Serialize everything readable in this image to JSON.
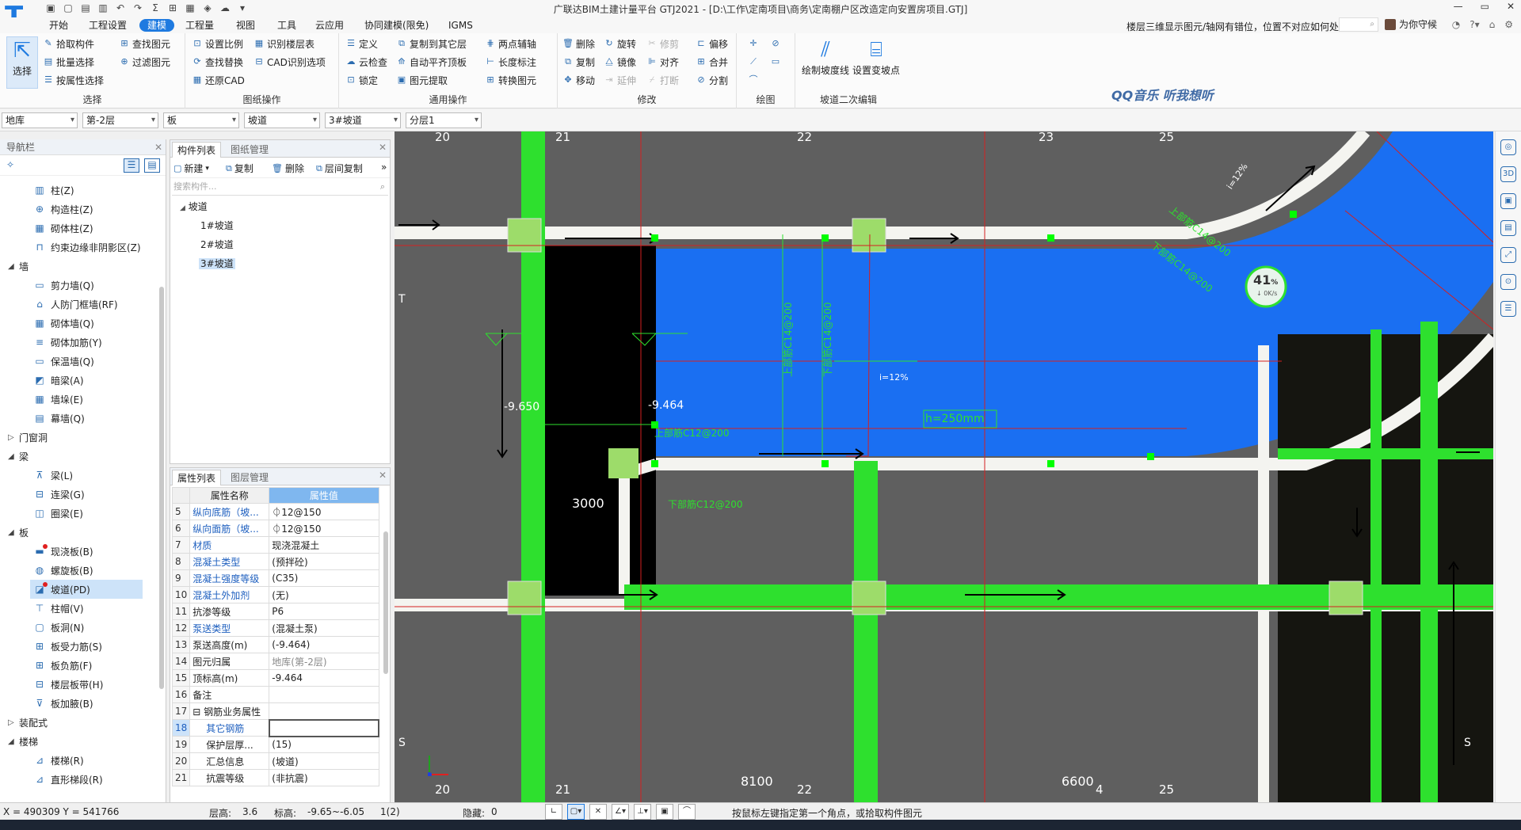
{
  "window": {
    "title": "广联达BIM土建计量平台 GTJ2021 - [D:\\工作\\定南项目\\商务\\定南棚户区改造定向安置房项目.GTJ]",
    "controls": [
      "—",
      "▭",
      "✕"
    ]
  },
  "menu": {
    "items": [
      "开始",
      "工程设置",
      "建模",
      "工程量",
      "视图",
      "工具",
      "云应用",
      "协同建模(限免)",
      "IGMS"
    ],
    "active": "建模",
    "notice": "楼层三维显示图元/轴网有错位，位置不对应如何处理?",
    "user": "为你守候"
  },
  "ribbon": {
    "select": {
      "big": "选择",
      "items": [
        "拾取构件",
        "批量选择",
        "按属性选择"
      ],
      "items2": [
        "查找图元",
        "过滤图元"
      ],
      "title": "选择"
    },
    "drawing": {
      "col1": [
        "设置比例",
        "查找替换",
        "还原CAD"
      ],
      "col2": [
        "识别楼层表",
        "CAD识别选项"
      ],
      "title": "图纸操作"
    },
    "general": {
      "col1": [
        "定义",
        "云检查",
        "锁定"
      ],
      "col2": [
        "复制到其它层",
        "自动平齐顶板",
        "图元提取"
      ],
      "col3": [
        "两点辅轴",
        "长度标注",
        "转换图元"
      ],
      "title": "通用操作"
    },
    "modify": {
      "col1": [
        "删除",
        "复制",
        "移动"
      ],
      "col2": [
        "旋转",
        "镜像",
        "延伸"
      ],
      "col3": [
        "修剪",
        "对齐",
        "打断"
      ],
      "col4": [
        "偏移",
        "合并",
        "分割"
      ],
      "title": "修改"
    },
    "draw": {
      "title": "绘图"
    },
    "ramp": {
      "b1": "绘制坡度线",
      "b2": "设置变坡点",
      "title": "坡道二次编辑"
    },
    "watermark": "QQ音乐 听我想听"
  },
  "filters": [
    "地库",
    "第-2层",
    "板",
    "坡道",
    "3#坡道",
    "分层1"
  ],
  "nav": {
    "title": "导航栏",
    "rows": [
      {
        "type": "sub",
        "icon": "▥",
        "label": "柱(Z)"
      },
      {
        "type": "sub",
        "icon": "⊕",
        "label": "构造柱(Z)"
      },
      {
        "type": "sub",
        "icon": "▦",
        "label": "砌体柱(Z)"
      },
      {
        "type": "sub",
        "icon": "⊓",
        "label": "约束边缘非阴影区(Z)"
      },
      {
        "type": "cat",
        "label": "墙",
        "open": true
      },
      {
        "type": "sub",
        "icon": "▭",
        "label": "剪力墙(Q)"
      },
      {
        "type": "sub",
        "icon": "⌂",
        "label": "人防门框墙(RF)"
      },
      {
        "type": "sub",
        "icon": "▦",
        "label": "砌体墙(Q)"
      },
      {
        "type": "sub",
        "icon": "≡",
        "label": "砌体加筋(Y)"
      },
      {
        "type": "sub",
        "icon": "▭",
        "label": "保温墙(Q)"
      },
      {
        "type": "sub",
        "icon": "◩",
        "label": "暗梁(A)"
      },
      {
        "type": "sub",
        "icon": "▦",
        "label": "墙垛(E)"
      },
      {
        "type": "sub",
        "icon": "▤",
        "label": "幕墙(Q)"
      },
      {
        "type": "cat",
        "label": "门窗洞",
        "open": false
      },
      {
        "type": "cat",
        "label": "梁",
        "open": true
      },
      {
        "type": "sub",
        "icon": "⊼",
        "label": "梁(L)"
      },
      {
        "type": "sub",
        "icon": "⊟",
        "label": "连梁(G)"
      },
      {
        "type": "sub",
        "icon": "◫",
        "label": "圈梁(E)"
      },
      {
        "type": "cat",
        "label": "板",
        "open": true
      },
      {
        "type": "sub",
        "icon": "▬",
        "label": "现浇板(B)",
        "dot": true
      },
      {
        "type": "sub",
        "icon": "◍",
        "label": "螺旋板(B)"
      },
      {
        "type": "sub",
        "icon": "◪",
        "label": "坡道(PD)",
        "dot": true,
        "selected": true
      },
      {
        "type": "sub",
        "icon": "⊤",
        "label": "柱帽(V)"
      },
      {
        "type": "sub",
        "icon": "▢",
        "label": "板洞(N)"
      },
      {
        "type": "sub",
        "icon": "⊞",
        "label": "板受力筋(S)"
      },
      {
        "type": "sub",
        "icon": "⊞",
        "label": "板负筋(F)"
      },
      {
        "type": "sub",
        "icon": "⊟",
        "label": "楼层板带(H)"
      },
      {
        "type": "sub",
        "icon": "⊽",
        "label": "板加腋(B)"
      },
      {
        "type": "cat",
        "label": "装配式",
        "open": false
      },
      {
        "type": "cat",
        "label": "楼梯",
        "open": true
      },
      {
        "type": "sub",
        "icon": "⊿",
        "label": "楼梯(R)"
      },
      {
        "type": "sub",
        "icon": "⊿",
        "label": "直形梯段(R)"
      }
    ]
  },
  "components": {
    "tabs": [
      "构件列表",
      "图纸管理"
    ],
    "tools": [
      "新建",
      "复制",
      "删除",
      "层间复制"
    ],
    "search_placeholder": "搜索构件...",
    "root": "坡道",
    "items": [
      "1#坡道",
      "2#坡道",
      "3#坡道"
    ],
    "selected": "3#坡道"
  },
  "properties": {
    "tabs": [
      "属性列表",
      "图层管理"
    ],
    "headers": [
      "属性名称",
      "属性值"
    ],
    "rows": [
      {
        "n": "5",
        "name": "纵向底筋（坡...",
        "value": "⏀12@150",
        "blue": true
      },
      {
        "n": "6",
        "name": "纵向面筋（坡...",
        "value": "⏀12@150",
        "blue": true
      },
      {
        "n": "7",
        "name": "材质",
        "value": "现浇混凝土",
        "blue": true
      },
      {
        "n": "8",
        "name": "混凝土类型",
        "value": "(预拌砼)",
        "blue": true
      },
      {
        "n": "9",
        "name": "混凝土强度等级",
        "value": "(C35)",
        "blue": true
      },
      {
        "n": "10",
        "name": "混凝土外加剂",
        "value": "(无)",
        "blue": true
      },
      {
        "n": "11",
        "name": "抗渗等级",
        "value": "P6"
      },
      {
        "n": "12",
        "name": "泵送类型",
        "value": "(混凝土泵)",
        "blue": true
      },
      {
        "n": "13",
        "name": "泵送高度(m)",
        "value": "(-9.464)"
      },
      {
        "n": "14",
        "name": "图元归属",
        "value": "地库(第-2层)",
        "gray": true
      },
      {
        "n": "15",
        "name": "顶标高(m)",
        "value": "-9.464"
      },
      {
        "n": "16",
        "name": "备注",
        "value": ""
      },
      {
        "n": "17",
        "name": "⊟ 钢筋业务属性",
        "value": ""
      },
      {
        "n": "18",
        "name": "其它钢筋",
        "value": "",
        "blue": true,
        "indent": true,
        "selected": true
      },
      {
        "n": "19",
        "name": "保护层厚...",
        "value": "(15)",
        "indent": true
      },
      {
        "n": "20",
        "name": "汇总信息",
        "value": "(坡道)",
        "indent": true
      },
      {
        "n": "21",
        "name": "抗震等级",
        "value": "(非抗震)",
        "indent": true
      }
    ]
  },
  "canvas": {
    "axes_top": [
      "20",
      "21",
      "22",
      "23",
      "25"
    ],
    "axes_bottom": [
      "20",
      "21",
      "22",
      "4",
      "25"
    ],
    "axes_side": [
      "T",
      "S"
    ],
    "dims": [
      "3000",
      "8100",
      "6600"
    ],
    "elevations": [
      "-9.650",
      "-9.464"
    ],
    "rebar": [
      "上部筋C14@200",
      "下部筋C14@200",
      "上部筋C12@200",
      "下部筋C12@200",
      "上部筋C14@200",
      "下部筋C14@200"
    ],
    "slope1": "i=12%",
    "slope2": "i=12%",
    "thickness": "h=250mm",
    "progress": {
      "percent": "41",
      "unit": "%",
      "speed": "↓ 0K/s"
    },
    "colors": {
      "bg": "#5f5f5f",
      "green": "#2ee02e",
      "blue": "#1a6ff2",
      "black": "#000000",
      "white": "#f4f4f0",
      "redline": "#d42020"
    }
  },
  "status": {
    "coords": "X = 490309 Y = 541766",
    "floor_height_label": "层高:",
    "floor_height": "3.6",
    "elev_label": "标高:",
    "elev": "-9.65~-6.05",
    "count": "1(2)",
    "hidden_label": "隐藏:",
    "hidden": "0",
    "hint": "按鼠标左键指定第一个角点，或拾取构件图元"
  }
}
